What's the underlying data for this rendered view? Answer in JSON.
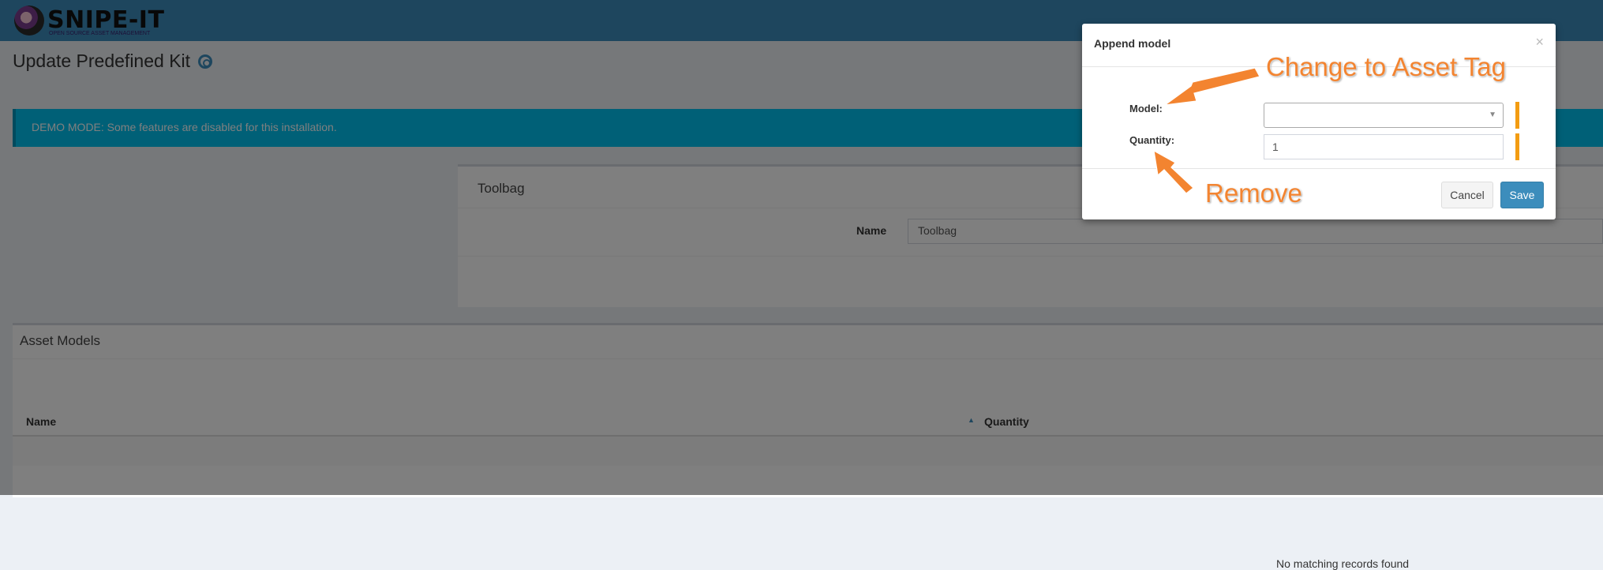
{
  "brand": {
    "name": "SNIPE-IT",
    "tagline": "OPEN SOURCE ASSET MANAGEMENT"
  },
  "page": {
    "title": "Update Predefined Kit"
  },
  "alert": {
    "text": "DEMO MODE: Some features are disabled for this installation."
  },
  "kit_box": {
    "title": "Toolbag",
    "name_label": "Name",
    "name_value": "Toolbag"
  },
  "models_box": {
    "title": "Asset Models",
    "columns": [
      "Name",
      "Quantity"
    ],
    "empty_text": "No matching records found"
  },
  "modal": {
    "title": "Append model",
    "close": "×",
    "model_label": "Model:",
    "model_value": "",
    "quantity_label": "Quantity:",
    "quantity_value": "1",
    "cancel_label": "Cancel",
    "save_label": "Save"
  },
  "annotations": {
    "change": "Change to Asset Tag",
    "remove": "Remove"
  },
  "colors": {
    "navbar": "#3c8dbc",
    "alert": "#00c0ef",
    "required": "#f39c12",
    "annotation": "#f38430",
    "primary_button": "#3c8dbc"
  }
}
